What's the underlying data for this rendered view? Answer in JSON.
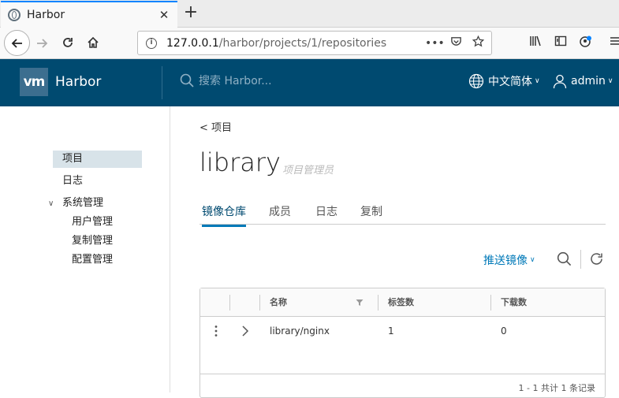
{
  "browser": {
    "tab_title": "Harbor",
    "tab_close": "✕",
    "new_tab": "+",
    "url_host": "127.0.0.1",
    "url_path": "/harbor/projects/1/repositories",
    "url_more": "•••"
  },
  "header": {
    "logo_text": "vm",
    "brand": "Harbor",
    "search_placeholder": "搜索 Harbor...",
    "language": "中文简体",
    "user": "admin"
  },
  "sidebar": {
    "items": [
      {
        "label": "项目"
      },
      {
        "label": "日志"
      },
      {
        "label": "系统管理"
      }
    ],
    "sub_items": [
      {
        "label": "用户管理"
      },
      {
        "label": "复制管理"
      },
      {
        "label": "配置管理"
      }
    ]
  },
  "main": {
    "breadcrumb": "< 项目",
    "project_name": "library",
    "role": "项目管理员",
    "tabs": [
      {
        "label": "镜像仓库"
      },
      {
        "label": "成员"
      },
      {
        "label": "日志"
      },
      {
        "label": "复制"
      }
    ],
    "push_image": "推送镜像"
  },
  "table": {
    "columns": [
      "名称",
      "标签数",
      "下载数"
    ],
    "rows": [
      {
        "name": "library/nginx",
        "tags": "1",
        "pulls": "0"
      }
    ],
    "footer": "1 - 1 共计 1 条记录"
  },
  "colors": {
    "header_bg": "#004a70",
    "accent": "#0079b8",
    "active_nav_bg": "#d8e3e9"
  }
}
